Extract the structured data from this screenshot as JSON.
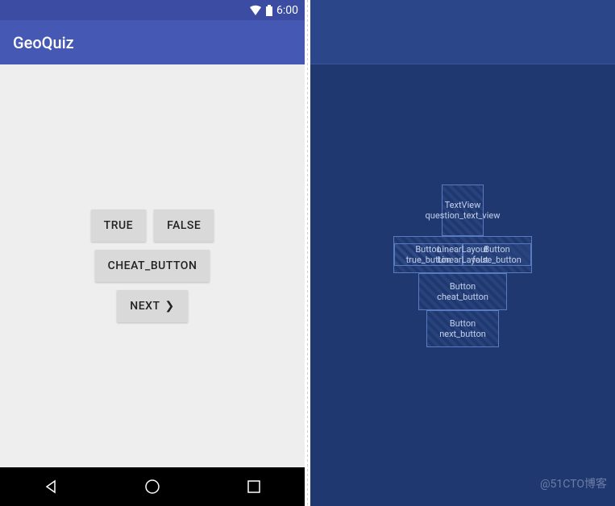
{
  "status": {
    "time": "6:00"
  },
  "app": {
    "title": "GeoQuiz"
  },
  "buttons": {
    "true_label": "TRUE",
    "false_label": "FALSE",
    "cheat_label": "CHEAT_BUTTON",
    "next_label": "NEXT",
    "next_arrow": "❯"
  },
  "blueprint": {
    "textview": {
      "type": "TextView",
      "id": "question_text_view"
    },
    "linearlayout": {
      "type": "LinearLayout",
      "inner": "LinearLayout"
    },
    "true_btn": {
      "type": "Button",
      "id": "true_button"
    },
    "false_btn": {
      "type": "Button",
      "id": "false_button"
    },
    "cheat_btn": {
      "type": "Button",
      "id": "cheat_button"
    },
    "next_btn": {
      "type": "Button",
      "id": "next_button"
    }
  },
  "watermark": "@51CTO博客"
}
